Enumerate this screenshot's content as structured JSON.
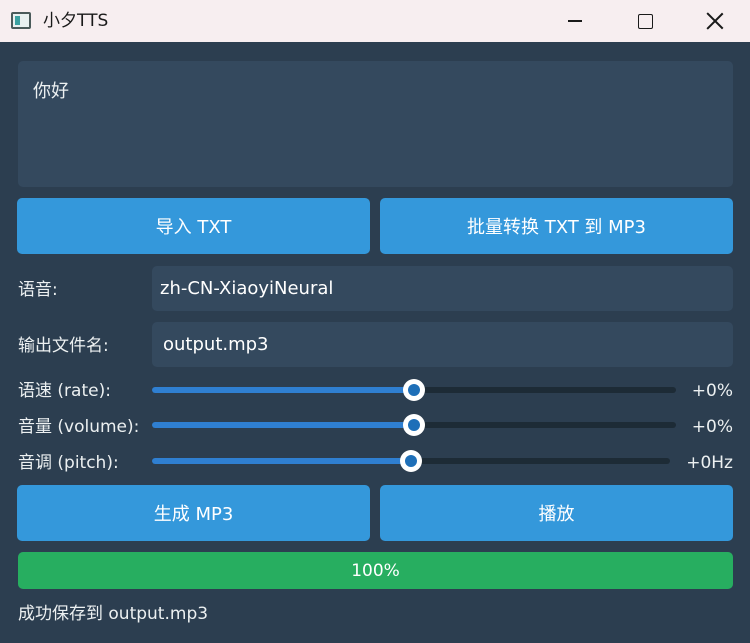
{
  "window": {
    "title": "小夕TTS"
  },
  "editor": {
    "text": "你好"
  },
  "buttons": {
    "import": "导入 TXT",
    "batch": "批量转换 TXT 到 MP3",
    "generate": "生成 MP3",
    "play": "播放"
  },
  "form": {
    "voice_label": "语音:",
    "voice_value": "zh-CN-XiaoyiNeural",
    "output_label": "输出文件名:",
    "output_value": "output.mp3"
  },
  "sliders": {
    "rate": {
      "label": "语速 (rate):",
      "value_text": "+0%",
      "level": 0.5
    },
    "volume": {
      "label": "音量 (volume):",
      "value_text": "+0%",
      "level": 0.5
    },
    "pitch": {
      "label": "音调 (pitch):",
      "value_text": "+0Hz",
      "level": 0.5
    }
  },
  "progress": {
    "text": "100%",
    "value": 1.0
  },
  "status": {
    "text": "成功保存到 output.mp3"
  },
  "colors": {
    "background": "#2c3e50",
    "field": "#34495e",
    "button": "#3498db",
    "progress": "#27ae60"
  },
  "icons": {
    "app": "app-window-icon",
    "minimize": "minimize-icon",
    "maximize": "maximize-icon",
    "close": "close-icon"
  }
}
